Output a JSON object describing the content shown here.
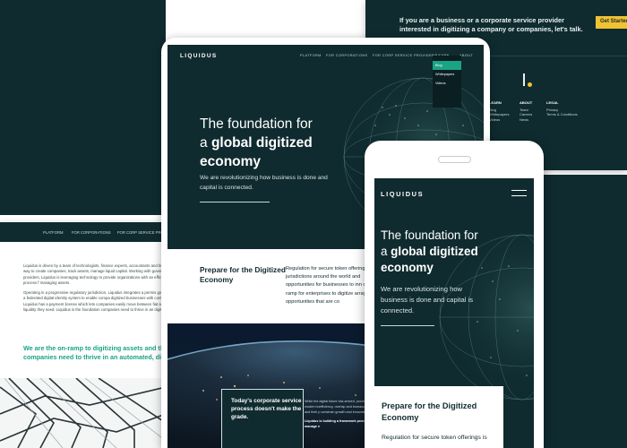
{
  "footer_panel": {
    "cta_text": "If you are a business or a corporate service provider interested in digitizing a company or companies, let's talk.",
    "cta_button": "Get Started",
    "columns": [
      {
        "heading": "",
        "items": [
          "",
          ""
        ]
      },
      {
        "heading": "LEARN",
        "items": [
          "Blog",
          "Whitepapers",
          "Videos"
        ]
      },
      {
        "heading": "ABOUT",
        "items": [
          "Team",
          "Careers",
          "News"
        ]
      },
      {
        "heading": "LEGAL",
        "items": [
          "Privacy",
          "Terms & Conditions"
        ]
      }
    ]
  },
  "left_doc": {
    "nav": [
      "PLATFORM",
      "FOR CORPORATIONS",
      "FOR CORP SERVICE PRO"
    ],
    "paragraphs": [
      "Liquidus is driven by a team of technologists, finance experts, accountants and building a more efficient way to create companies, track assets, manage liquid capital. Working with governments and service providers, Liquidus is leveraging technology to provide organizations with an efficient and compliant process f managing assets.",
      "Operating in a progressive regulatory jurisdiction, Liquidus integrates a permis governed blockchain with a federated digital identity system to enable compa digitized businesses with confidence and compliance. Liquidus has a payment license which lets companies easily move between fiat and token currencies liquidity they need. Liquidus is the foundation companies need to thrive in an digital economy."
    ],
    "highlight": "We are the on-ramp to digitizing assets and the foundat companies need to thrive in an automated, digital eco"
  },
  "tablet": {
    "brand": "LIQUIDUS",
    "nav": [
      "PLATFORM",
      "FOR CORPORATIONS",
      "FOR CORP SERVICE PROVIDERS",
      "LEARN",
      "ABOUT"
    ],
    "menu": [
      "Blog",
      "Whitepapers",
      "Videos"
    ],
    "hero_title_1": "The foundation for",
    "hero_title_2": "a ",
    "hero_title_bold": "global digitized economy",
    "hero_sub": "We are revolutionizing how business is done and capital is connected.",
    "prepare": "Prepare for the Digitized Economy",
    "regulation": "Regulation for secure token offerings jurisdictions around the world and opportunities for businesses to inn on-ramp for enterprises to digitize array of opportunities that are co",
    "quote": "Today's corporate service process doesn't make the grade.",
    "dark_text": "While the digital future has arrived, processes to set up and run a modern inefficiency, overlap and bureaucra reporting requirements and their p constrain growth and innovation.",
    "dark_text_bold": "Liquidus is building a framework process to digitize and manage e"
  },
  "phone": {
    "brand": "LIQUIDUS",
    "hero_title_1": "The foundation for",
    "hero_title_2": "a ",
    "hero_title_bold": "global digitized economy",
    "hero_sub": "We are revolutionizing how business is done and capital is connected.",
    "prepare": "Prepare for the Digitized Economy",
    "regulation": "Regulation for secure token offerings is"
  },
  "colors": {
    "dark_teal": "#0f2b2f",
    "accent_green": "#1ba386",
    "accent_yellow": "#f1c232"
  }
}
